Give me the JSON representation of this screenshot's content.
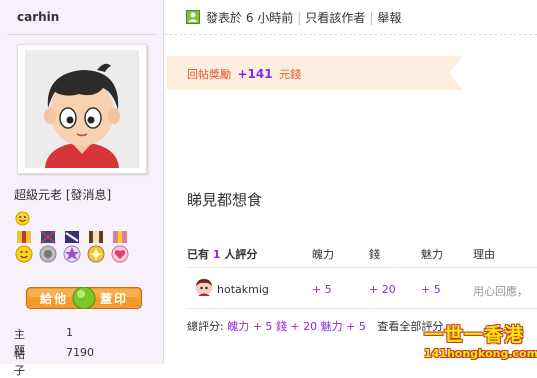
{
  "user": {
    "name": "carhin",
    "rank": "超級元老",
    "message_link": "[發消息]",
    "give_button": "給他",
    "stamp_button": "蓋印",
    "stats": [
      {
        "label": "主題",
        "value": "1"
      },
      {
        "label": "帖子",
        "value": "7190"
      }
    ]
  },
  "post_meta": {
    "posted_prefix": "發表於",
    "posted_time": "6 小時前",
    "only_author": "只看該作者",
    "report": "舉報"
  },
  "reward": {
    "label": "回帖獎勵",
    "amount": "+141",
    "unit": "元錢"
  },
  "message": "睇見都想食",
  "rating": {
    "header_prefix": "已有",
    "header_count": "1",
    "header_suffix": "人評分",
    "columns": [
      "魄力",
      "錢",
      "魅力",
      "理由"
    ],
    "rows": [
      {
        "user": "hotakmig",
        "values": [
          "+ 5",
          "+ 20",
          "+ 5"
        ],
        "reason": "用心回應，"
      }
    ],
    "total": {
      "label": "總評分:",
      "parts": [
        "魄力 + 5",
        "錢 + 20",
        "魅力 + 5"
      ],
      "view_all": "查看全部評分"
    }
  },
  "watermark": {
    "top": "一世一香港",
    "bottom": "141hongkong.com"
  },
  "colors": {
    "sidebar_bg": "#f6f1fa",
    "reward_bg": "#fbeedf",
    "accent_purple": "#8a2be2",
    "reward_text": "#e05a2b",
    "give_button_bg": "#f39a2a"
  }
}
